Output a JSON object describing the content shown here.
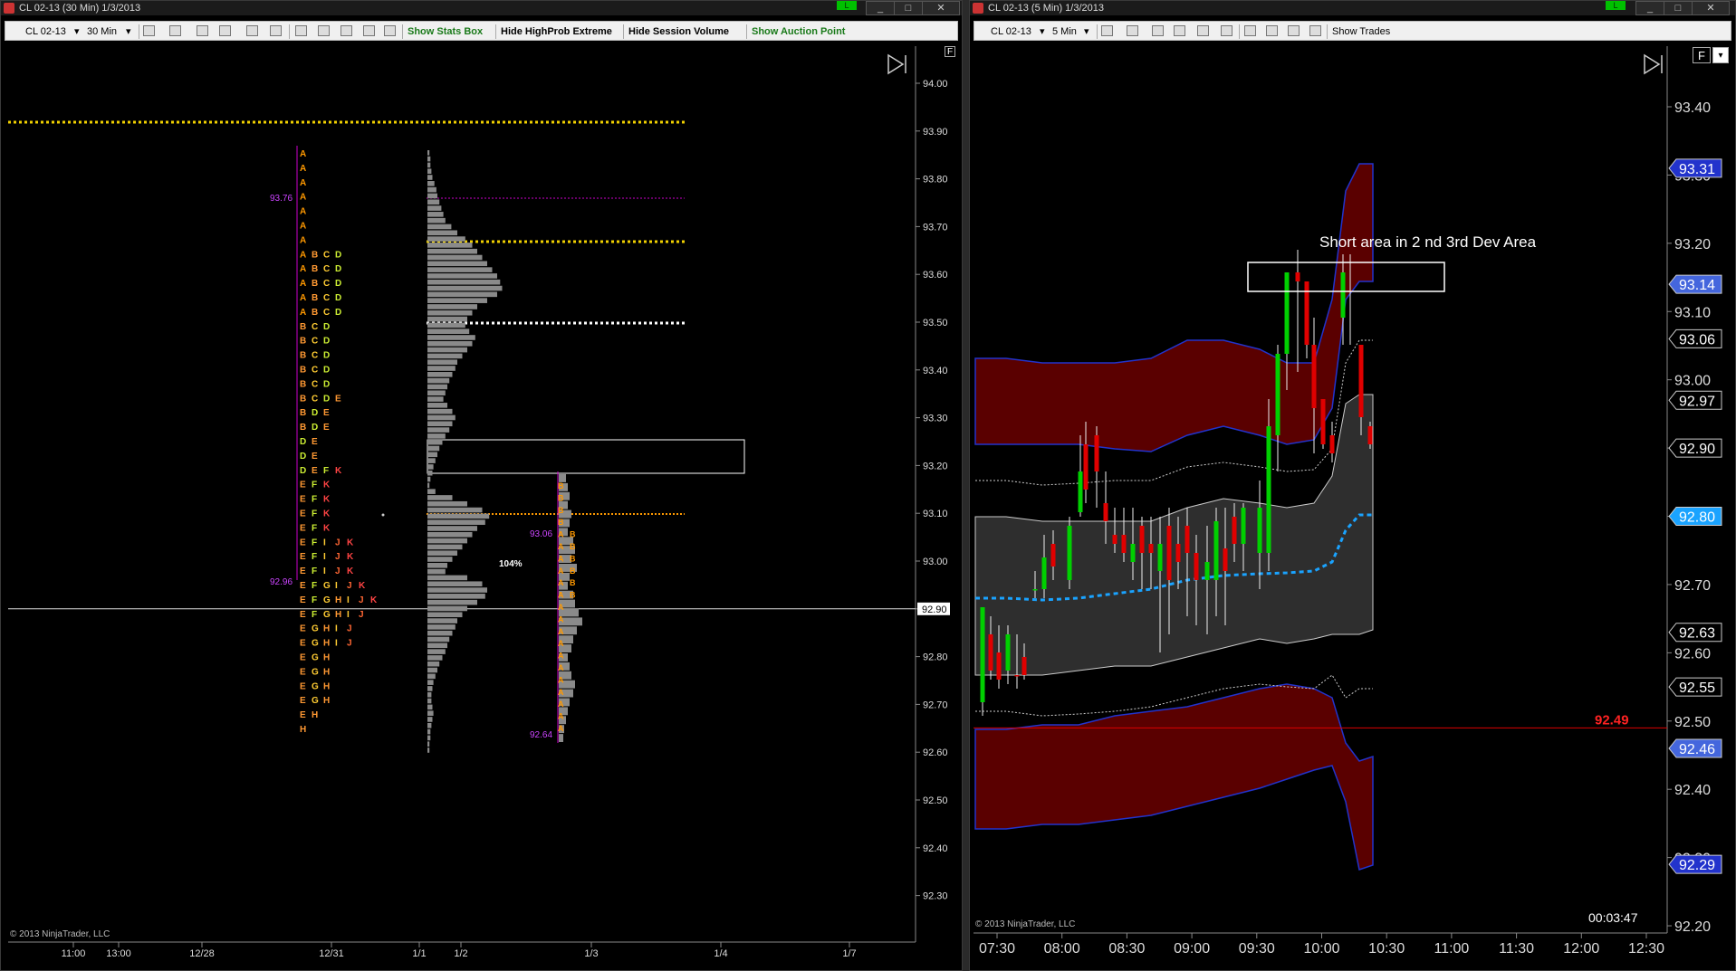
{
  "left": {
    "title": "CL 02-13 (30 Min)  1/3/2013",
    "toolbar": {
      "instrument": "CL 02-13",
      "interval": "30 Min",
      "show_stats": "Show Stats Box",
      "hide_highprob": "Hide HighProb Extreme",
      "hide_session": "Hide Session Volume",
      "show_auction": "Show Auction Point"
    },
    "copyright": "© 2013 NinjaTrader, LLC",
    "price_axis": [
      "94.00",
      "93.90",
      "93.80",
      "93.70",
      "93.60",
      "93.50",
      "93.40",
      "93.30",
      "93.20",
      "93.10",
      "93.00",
      "92.90",
      "92.80",
      "92.70",
      "92.60",
      "92.50",
      "92.40",
      "92.30"
    ],
    "current_price": "92.90",
    "time_labels": [
      "11:00",
      "13:00",
      "12/28",
      "12/31",
      "1/1",
      "1/2",
      "1/3",
      "1/4",
      "1/7"
    ],
    "profile_labels": {
      "high": "93.76",
      "low": "92.96",
      "pct": "104%",
      "right_high": "93.06",
      "right_low": "92.64"
    },
    "tpo_rows": [
      [
        "A"
      ],
      [
        "A"
      ],
      [
        "A"
      ],
      [
        "A"
      ],
      [
        "A"
      ],
      [
        "A"
      ],
      [
        "A"
      ],
      [
        "A",
        "B",
        "C",
        "D"
      ],
      [
        "A",
        "B",
        "C",
        "D"
      ],
      [
        "A",
        "B",
        "C",
        "D"
      ],
      [
        "A",
        "B",
        "C",
        "D"
      ],
      [
        "A",
        "B",
        "C",
        "D"
      ],
      [
        "B",
        "C",
        "D"
      ],
      [
        "B",
        "C",
        "D"
      ],
      [
        "B",
        "C",
        "D"
      ],
      [
        "B",
        "C",
        "D"
      ],
      [
        "B",
        "C",
        "D"
      ],
      [
        "B",
        "C",
        "D",
        "E"
      ],
      [
        "B",
        "D",
        "E"
      ],
      [
        "B",
        "D",
        "E"
      ],
      [
        "D",
        "E"
      ],
      [
        "D",
        "E"
      ],
      [
        "D",
        "E",
        "F",
        "K"
      ],
      [
        "E",
        "F",
        "K"
      ],
      [
        "E",
        "F",
        "K"
      ],
      [
        "E",
        "F",
        "K"
      ],
      [
        "E",
        "F",
        "K"
      ],
      [
        "E",
        "F",
        "I",
        "J",
        "K"
      ],
      [
        "E",
        "F",
        "I",
        "J",
        "K"
      ],
      [
        "E",
        "F",
        "I",
        "J",
        "K"
      ],
      [
        "E",
        "F",
        "G",
        "I",
        "J",
        "K"
      ],
      [
        "E",
        "F",
        "G",
        "H",
        "I",
        "J",
        "K"
      ],
      [
        "E",
        "F",
        "G",
        "H",
        "I",
        "J"
      ],
      [
        "E",
        "G",
        "H",
        "I",
        "J"
      ],
      [
        "E",
        "G",
        "H",
        "I",
        "J"
      ],
      [
        "E",
        "G",
        "H"
      ],
      [
        "E",
        "G",
        "H"
      ],
      [
        "E",
        "G",
        "H"
      ],
      [
        "E",
        "G",
        "H"
      ],
      [
        "E",
        "H"
      ],
      [
        "H"
      ]
    ],
    "right_profile_rows": [
      [
        "B"
      ],
      [
        "B"
      ],
      [
        "B"
      ],
      [
        "B"
      ],
      [
        "A",
        "B"
      ],
      [
        "A",
        "B"
      ],
      [
        "A",
        "B"
      ],
      [
        "A",
        "B"
      ],
      [
        "A",
        "B"
      ],
      [
        "A",
        "B"
      ],
      [
        "A"
      ],
      [
        "A"
      ],
      [
        "A"
      ],
      [
        "A"
      ],
      [
        "A"
      ],
      [
        "A"
      ],
      [
        "A"
      ],
      [
        "A"
      ],
      [
        "A"
      ],
      [
        "A"
      ],
      [
        "A"
      ]
    ]
  },
  "right": {
    "title": "CL 02-13 (5 Min)  1/3/2013",
    "toolbar": {
      "instrument": "CL 02-13",
      "interval": "5 Min",
      "show_trades": "Show Trades"
    },
    "annotation": "Short area in 2 nd 3rd Dev Area",
    "copyright": "© 2013 NinjaTrader, LLC",
    "timer": "00:03:47",
    "price_axis": [
      "93.40",
      "93.30",
      "93.20",
      "93.10",
      "93.00",
      "92.90",
      "92.80",
      "92.70",
      "92.60",
      "92.50",
      "92.40",
      "92.30",
      "92.20"
    ],
    "price_markers": [
      {
        "label": "93.31",
        "color": "#2233cc"
      },
      {
        "label": "93.14",
        "color": "#4466dd"
      },
      {
        "label": "93.06",
        "color": "#000000"
      },
      {
        "label": "92.97",
        "color": "#000000"
      },
      {
        "label": "92.90",
        "color": "#000000"
      },
      {
        "label": "92.80",
        "color": "#1aa3ff"
      },
      {
        "label": "92.63",
        "color": "#000000"
      },
      {
        "label": "92.55",
        "color": "#000000"
      },
      {
        "label": "92.46",
        "color": "#4466dd"
      },
      {
        "label": "92.29",
        "color": "#2233cc"
      }
    ],
    "red_line_label": "92.49",
    "time_labels": [
      "07:30",
      "08:00",
      "08:30",
      "09:00",
      "09:30",
      "10:00",
      "10:30",
      "11:00",
      "11:30",
      "12:00",
      "12:30"
    ]
  },
  "colors": {
    "band_red": "#5a0000",
    "band_gray": "#2e2e2e",
    "vwap": "#1aa3ff",
    "up": "#00d000",
    "down": "#e00000",
    "yellow_line": "#f0d000"
  }
}
